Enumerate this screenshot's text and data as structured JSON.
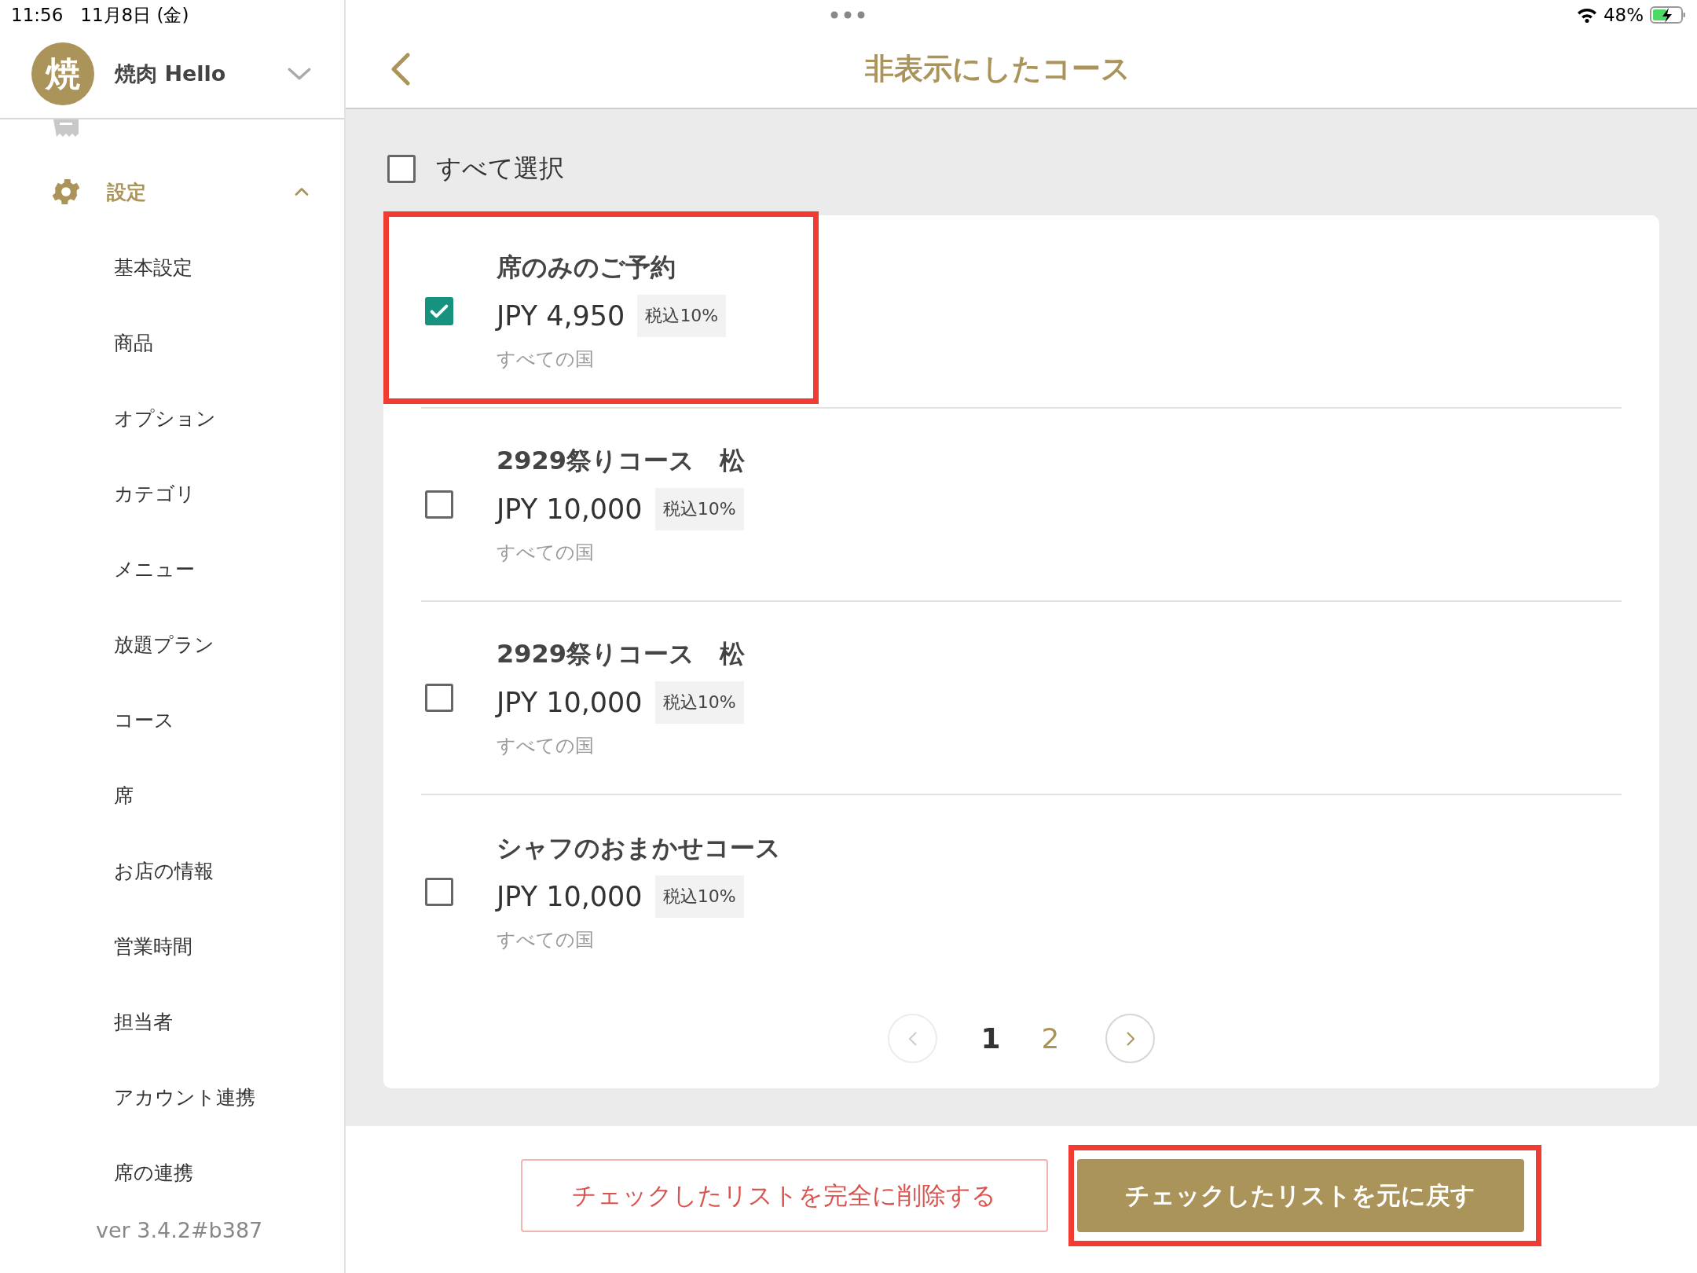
{
  "status_bar": {
    "time": "11:56",
    "date": "11月8日 (金)",
    "battery": "48%"
  },
  "sidebar": {
    "avatar": "焼",
    "shop_name": "焼肉 Hello",
    "section": {
      "label": "設定",
      "expanded": true
    },
    "items": [
      {
        "label": "基本設定"
      },
      {
        "label": "商品"
      },
      {
        "label": "オプション"
      },
      {
        "label": "カテゴリ"
      },
      {
        "label": "メニュー"
      },
      {
        "label": "放題プラン"
      },
      {
        "label": "コース"
      },
      {
        "label": "席"
      },
      {
        "label": "お店の情報"
      },
      {
        "label": "営業時間"
      },
      {
        "label": "担当者"
      },
      {
        "label": "アカウント連携"
      },
      {
        "label": "席の連携"
      }
    ],
    "version": "ver 3.4.2#b387"
  },
  "header": {
    "title": "非表示にしたコース"
  },
  "select_all": {
    "label": "すべて選択",
    "checked": false
  },
  "courses": [
    {
      "name": "席のみのご予約",
      "price": "JPY 4,950",
      "tax": "税込10%",
      "region": "すべての国",
      "checked": true,
      "highlighted": true
    },
    {
      "name": "2929祭りコース　松",
      "price": "JPY 10,000",
      "tax": "税込10%",
      "region": "すべての国",
      "checked": false,
      "highlighted": false
    },
    {
      "name": "2929祭りコース　松",
      "price": "JPY 10,000",
      "tax": "税込10%",
      "region": "すべての国",
      "checked": false,
      "highlighted": false
    },
    {
      "name": "シャフのおまかせコース",
      "price": "JPY 10,000",
      "tax": "税込10%",
      "region": "すべての国",
      "checked": false,
      "highlighted": false
    }
  ],
  "pagination": {
    "pages": [
      {
        "label": "1",
        "selected": true
      },
      {
        "label": "2",
        "selected": false
      }
    ]
  },
  "actions": [
    {
      "kind": "outline",
      "label": "チェックしたリストを完全に削除する",
      "highlighted": false
    },
    {
      "kind": "filled",
      "label": "チェックしたリストを元に戻す",
      "highlighted": true
    }
  ]
}
